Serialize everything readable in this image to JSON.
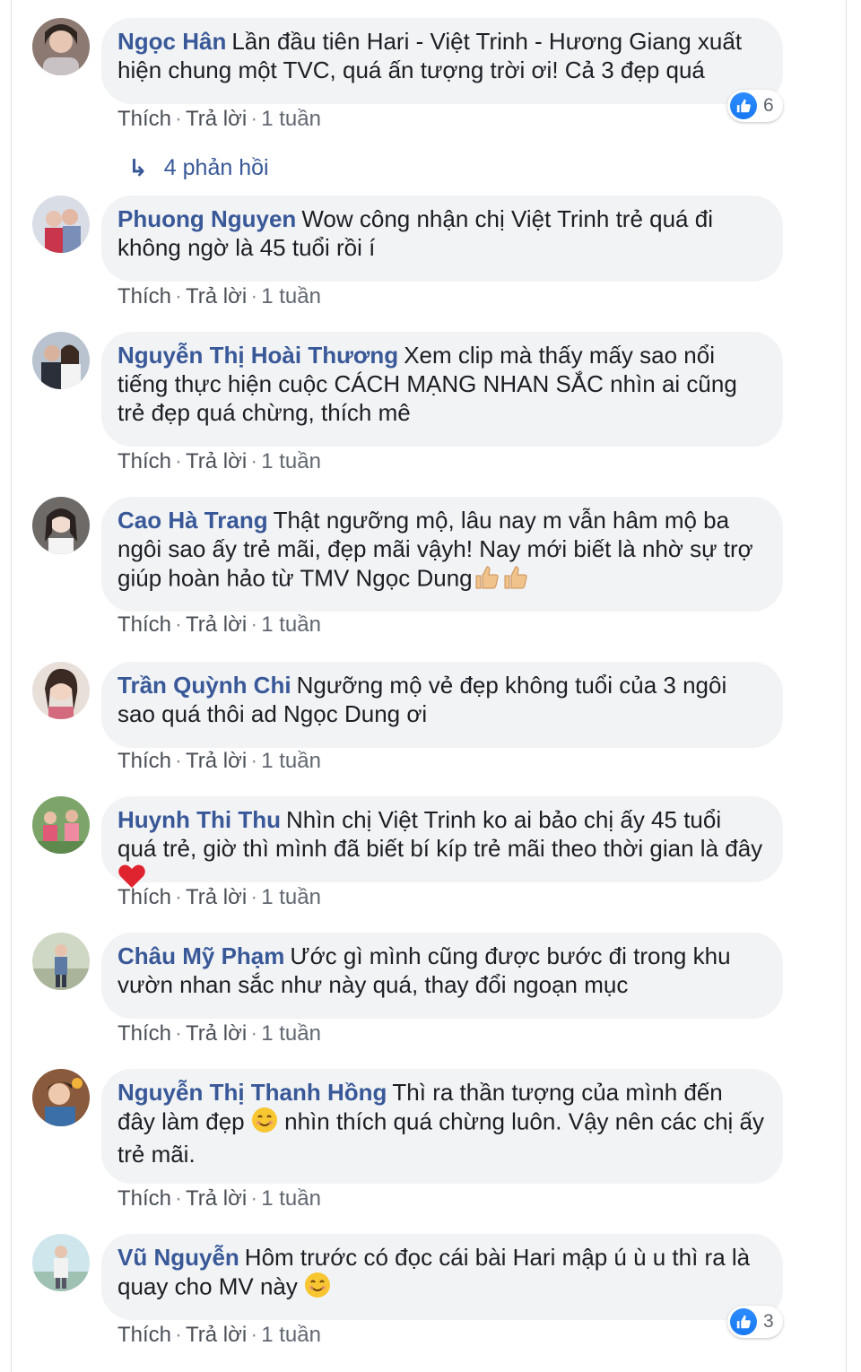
{
  "actions": {
    "like": "Thích",
    "reply": "Trả lời",
    "sep": "·"
  },
  "colors": {
    "author": "#385898",
    "bubble": "#f2f3f5",
    "like": "#1778f2"
  },
  "comments": [
    {
      "author": "Ngọc Hân",
      "text": "Lần đầu tiên Hari - Việt Trinh - Hương Giang xuất hiện chung một TVC, quá ấn tượng trời ơi! Cả 3 đẹp quá",
      "time": "1 tuần",
      "reactions": "6",
      "replies": "4 phản hồi"
    },
    {
      "author": "Phuong Nguyen",
      "text": "Wow công nhận chị Việt Trinh trẻ quá đi không ngờ là 45 tuổi rồi í",
      "time": "1 tuần"
    },
    {
      "author": "Nguyễn Thị Hoài Thương",
      "text": "Xem clip mà thấy mấy sao nổi tiếng thực hiện cuộc CÁCH MẠNG NHAN SẮC nhìn ai cũng trẻ đẹp quá chừng, thích mê",
      "time": "1 tuần"
    },
    {
      "author": "Cao Hà Trang",
      "text": "Thật ngưỡng mộ, lâu nay m vẫn hâm mộ ba ngôi sao ấy trẻ mãi, đẹp mãi vậyh! Nay mới biết là nhờ sự trợ giúp hoàn hảo từ TMV Ngọc Dung",
      "time": "1 tuần",
      "emoji": "thumbs-up-emoji thumbs-up-emoji"
    },
    {
      "author": "Trần Quỳnh Chi",
      "text": "Ngưỡng mộ vẻ đẹp không tuổi của 3 ngôi sao quá thôi ad Ngọc Dung ơi",
      "time": "1 tuần"
    },
    {
      "author": "Huynh Thi Thu",
      "text": "Nhìn chị Việt Trinh ko ai bảo chị ấy 45 tuổi quá trẻ, giờ thì mình đã biết bí kíp trẻ mãi theo thời gian là đây",
      "time": "1 tuần",
      "emoji": "red-heart-emoji"
    },
    {
      "author": "Châu Mỹ Phạm",
      "text": "Ước gì mình cũng được bước đi trong khu vườn nhan sắc như này quá, thay đổi ngoạn mục",
      "time": "1 tuần"
    },
    {
      "author": "Nguyễn Thị Thanh Hồng",
      "text_before": "Thì ra thần tượng của mình đến đây làm đẹp",
      "text_after": "nhìn thích quá chừng luôn. Vậy nên các chị ấy trẻ mãi.",
      "time": "1 tuần",
      "emoji": "smiling-face-emoji"
    },
    {
      "author": "Vũ Nguyễn",
      "text": "Hôm trước có đọc cái bài Hari mập ú ù u thì ra là quay cho MV này",
      "time": "1 tuần",
      "reactions": "3",
      "emoji": "smiling-face-emoji"
    }
  ]
}
